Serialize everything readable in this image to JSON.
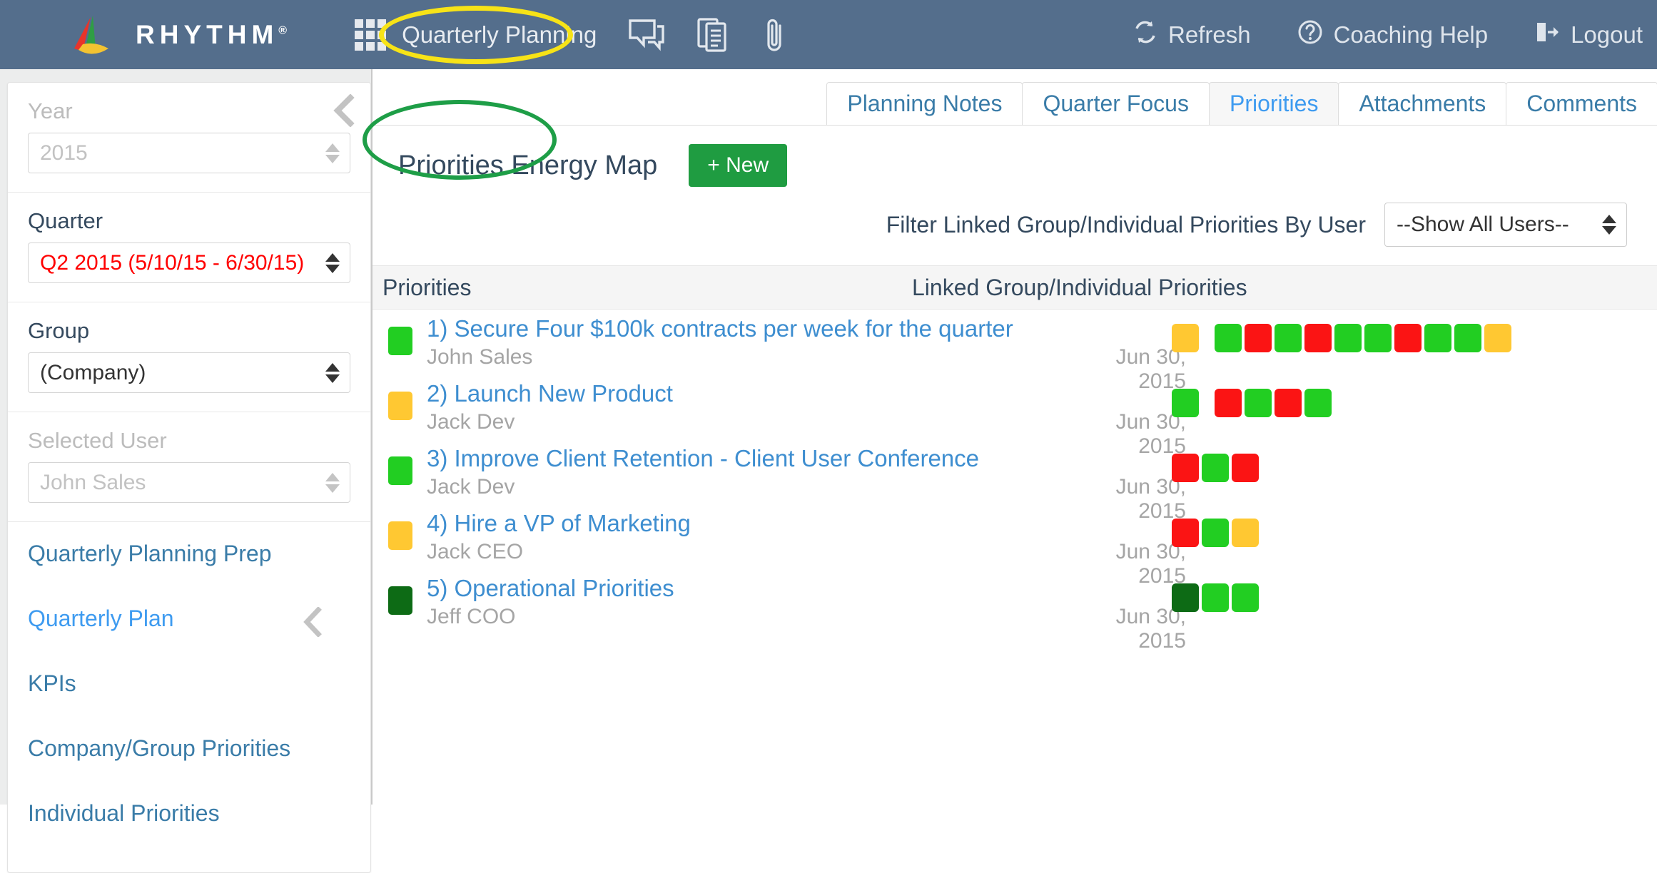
{
  "colors": {
    "header_bg": "#546e8c",
    "green": "#22ce22",
    "dark_green": "#0d6b15",
    "red": "#fb1414",
    "yellow": "#ffc832",
    "accent_blue": "#3e9bf0",
    "link_blue": "#3a7ca8",
    "new_button": "#1f9c41",
    "highlight_yellow": "#f7e317",
    "highlight_green": "#1e9e47",
    "quarter_red": "#ff0000"
  },
  "header": {
    "brand": "RHYTHM",
    "brand_mark": "®",
    "app_label": "Quarterly Planning",
    "icons": [
      "grid-apps-icon",
      "chat-bubble-icon",
      "copy-documents-icon",
      "paperclip-icon"
    ],
    "actions": [
      {
        "label": "Refresh",
        "icon": "refresh-icon"
      },
      {
        "label": "Coaching Help",
        "icon": "question-circle-icon"
      },
      {
        "label": "Logout",
        "icon": "logout-icon"
      }
    ]
  },
  "sidebar": {
    "year": {
      "label": "Year",
      "value": "2015",
      "disabled": true
    },
    "quarter": {
      "label": "Quarter",
      "value": "Q2 2015 (5/10/15 - 6/30/15)"
    },
    "group": {
      "label": "Group",
      "value": "(Company)"
    },
    "selected_user": {
      "label": "Selected User",
      "value": "John Sales",
      "disabled": true
    },
    "nav": [
      {
        "label": "Quarterly Planning Prep",
        "active": false,
        "chevron": false
      },
      {
        "label": "Quarterly Plan",
        "active": true,
        "chevron": true
      },
      {
        "label": "KPIs",
        "active": false,
        "chevron": false
      },
      {
        "label": "Company/Group Priorities",
        "active": false,
        "chevron": false
      },
      {
        "label": "Individual Priorities",
        "active": false,
        "chevron": false
      }
    ]
  },
  "main": {
    "tabs": [
      {
        "label": "Planning Notes",
        "active": false
      },
      {
        "label": "Quarter Focus",
        "active": false
      },
      {
        "label": "Priorities",
        "active": true
      },
      {
        "label": "Attachments",
        "active": false
      },
      {
        "label": "Comments",
        "active": false
      }
    ],
    "page_title": "Priorities Energy Map",
    "new_button": "+ New",
    "filter_label": "Filter Linked Group/Individual Priorities By User",
    "filter_value": "--Show All Users--",
    "columns": {
      "priorities": "Priorities",
      "linked": "Linked Group/Individual Priorities"
    },
    "rows": [
      {
        "status": "green",
        "title": "1) Secure Four $100k contracts per week for the quarter",
        "owner": "John Sales",
        "date": "Jun 30, 2015",
        "chips": [
          "yellow",
          "green",
          "red",
          "green",
          "red",
          "green",
          "green",
          "red",
          "green",
          "green",
          "yellow"
        ],
        "leading_gap": true
      },
      {
        "status": "yellow",
        "title": "2) Launch New Product",
        "owner": "Jack Dev",
        "date": "Jun 30, 2015",
        "chips": [
          "green",
          "red",
          "green",
          "red",
          "green"
        ],
        "leading_gap": true
      },
      {
        "status": "green",
        "title": "3) Improve Client Retention - Client User Conference",
        "owner": "Jack Dev",
        "date": "Jun 30, 2015",
        "chips": [
          "red",
          "green",
          "red"
        ],
        "leading_gap": false
      },
      {
        "status": "yellow",
        "title": "4) Hire a VP of Marketing",
        "owner": "Jack CEO",
        "date": "Jun 30, 2015",
        "chips": [
          "red",
          "green",
          "yellow"
        ],
        "leading_gap": false
      },
      {
        "status": "dark_green",
        "title": "5) Operational Priorities",
        "owner": "Jeff COO",
        "date": "Jun 30, 2015",
        "chips": [
          "dark_green",
          "green",
          "green"
        ],
        "leading_gap": false
      }
    ]
  }
}
